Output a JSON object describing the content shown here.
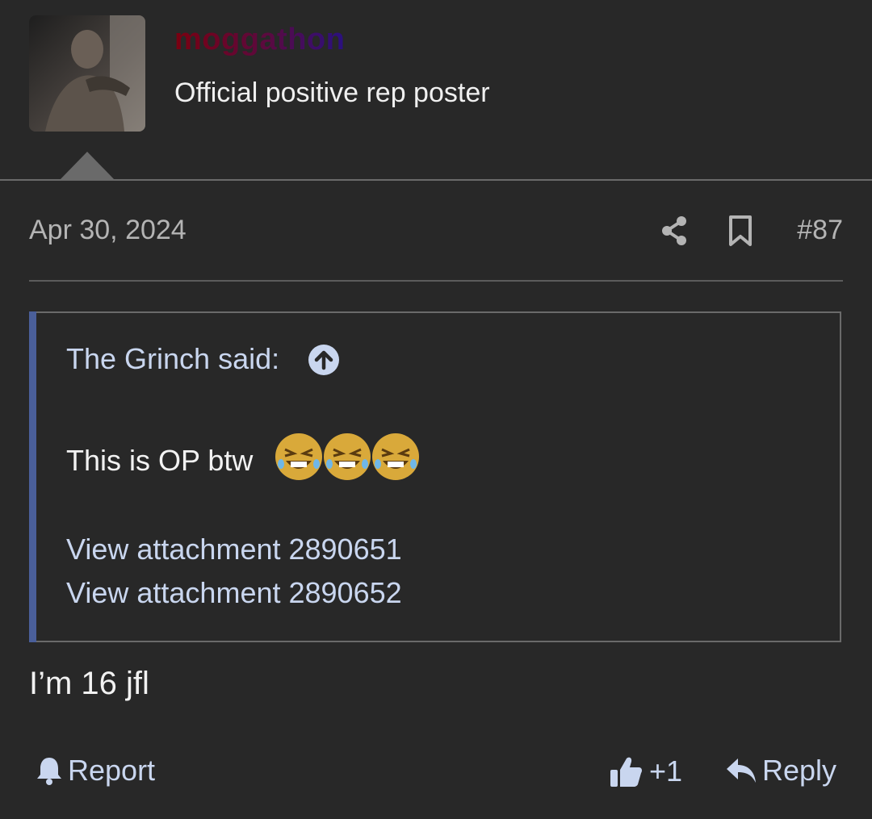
{
  "user": {
    "username": "moggathon",
    "title": "Official positive rep poster"
  },
  "meta": {
    "date": "Apr 30, 2024",
    "post_number": "#87",
    "icons": [
      "share-icon",
      "bookmark-icon"
    ]
  },
  "quote": {
    "author": "The Grinch said:",
    "text": "This is OP btw",
    "emoji_icon": "laughing-crying-emoji",
    "attachments": [
      "View attachment 2890651",
      "View attachment 2890652"
    ]
  },
  "post": {
    "body": "I’m 16 jfl"
  },
  "actions": {
    "report_label": "Report",
    "like_count": "+1",
    "reply_label": "Reply"
  },
  "colors": {
    "background": "#282828",
    "link": "#c9d6ef",
    "quote_accent": "#4a5f9a"
  }
}
